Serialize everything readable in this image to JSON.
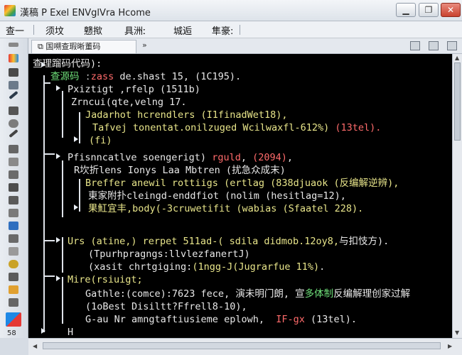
{
  "window": {
    "title": "漢稿 P  Exel   ENVglVra Hcome"
  },
  "menu": {
    "items": [
      "查一",
      "须坟",
      "戆揿",
      "具洲ː",
      "城逅",
      "隼豪:"
    ]
  },
  "tab": {
    "label": "国嗍查瑕晰董码",
    "pin": "»"
  },
  "toolbox": {
    "zoom": "58"
  },
  "colors": {
    "accent_red": "#ff6b6b",
    "accent_green": "#6fe07a",
    "accent_yellow": "#e8e58a",
    "editor_bg": "#000000"
  },
  "code": {
    "lines": [
      [
        {
          "t": "查理蹓码代码):",
          "c": "w"
        }
      ],
      [
        {
          "t": "查源码 ",
          "c": "g"
        },
        {
          "t": "ː",
          "c": "w"
        },
        {
          "t": "zass",
          "c": "r"
        },
        {
          "t": " de.shast 15, (1C195).",
          "c": "w"
        }
      ],
      [
        {
          "t": "Pxiztigt ,rfelp (1511b)",
          "c": "w"
        }
      ],
      [
        {
          "t": "Zrncui(qte,velng 17.",
          "c": "w"
        }
      ],
      [
        {
          "t": "Jadarhot hcrendlers (I1finadWet18),",
          "c": "y"
        }
      ],
      [
        {
          "t": "Tafvej tonentat.onilzuged Wcilwaxfl-612%) ",
          "c": "y"
        },
        {
          "t": "(13tel).",
          "c": "r"
        }
      ],
      [
        {
          "t": "(fi)",
          "c": "y"
        }
      ],
      [
        {
          "t": "Pfisnncatlve soengerigt) ",
          "c": "w"
        },
        {
          "t": "rguld",
          "c": "r"
        },
        {
          "t": ", ",
          "c": "w"
        },
        {
          "t": "(2094)",
          "c": "r"
        },
        {
          "t": ",",
          "c": "w"
        }
      ],
      [
        {
          "t": "R坎折lens Ionys Laa Mbtren (扰急众成末)",
          "c": "w"
        }
      ],
      [
        {
          "t": "Breffer anewil rottiigs (ertlag (838djuaok (反编解逆辨),",
          "c": "y"
        }
      ],
      [
        {
          "t": "東家附扑cleingd-enddfiot (nolim (hesitlag=12),",
          "c": "w"
        }
      ],
      [
        {
          "t": "果魟宜丰,body(-3cruwetifit (wabias (Sfaatel 228).",
          "c": "y"
        }
      ],
      [
        {
          "t": "Urs (atine,) rerpet 511ad-( sdila didmob.12oy8,",
          "c": "y"
        },
        {
          "t": "与扣忮方).",
          "c": "w"
        }
      ],
      [
        {
          "t": "(Tpurhpragngs:llvlezfanertJ)",
          "c": "w"
        }
      ],
      [
        {
          "t": "(xasit chrtgiging:",
          "c": "w"
        },
        {
          "t": "(1ngg-J(Jugrarfue 11%)",
          "c": "y"
        },
        {
          "t": ".",
          "c": "w"
        }
      ],
      [
        {
          "t": "Mire(rsiuigt;",
          "c": "y"
        }
      ],
      [
        {
          "t": "Gathle:(comce):7623 fece, 演未明门朗, 宣",
          "c": "w"
        },
        {
          "t": "多体制",
          "c": "g"
        },
        {
          "t": "反编解理创家过解",
          "c": "w"
        }
      ],
      [
        {
          "t": "(1oBest Disiltt?Ffrell8-10),",
          "c": "w"
        }
      ],
      [
        {
          "t": "G-au Nr amngtaftiusieme eplowh,  ",
          "c": "w"
        },
        {
          "t": "IF-gx",
          "c": "r"
        },
        {
          "t": " (13tel).",
          "c": "w"
        }
      ],
      [
        {
          "t": "H",
          "c": "w"
        }
      ]
    ]
  }
}
